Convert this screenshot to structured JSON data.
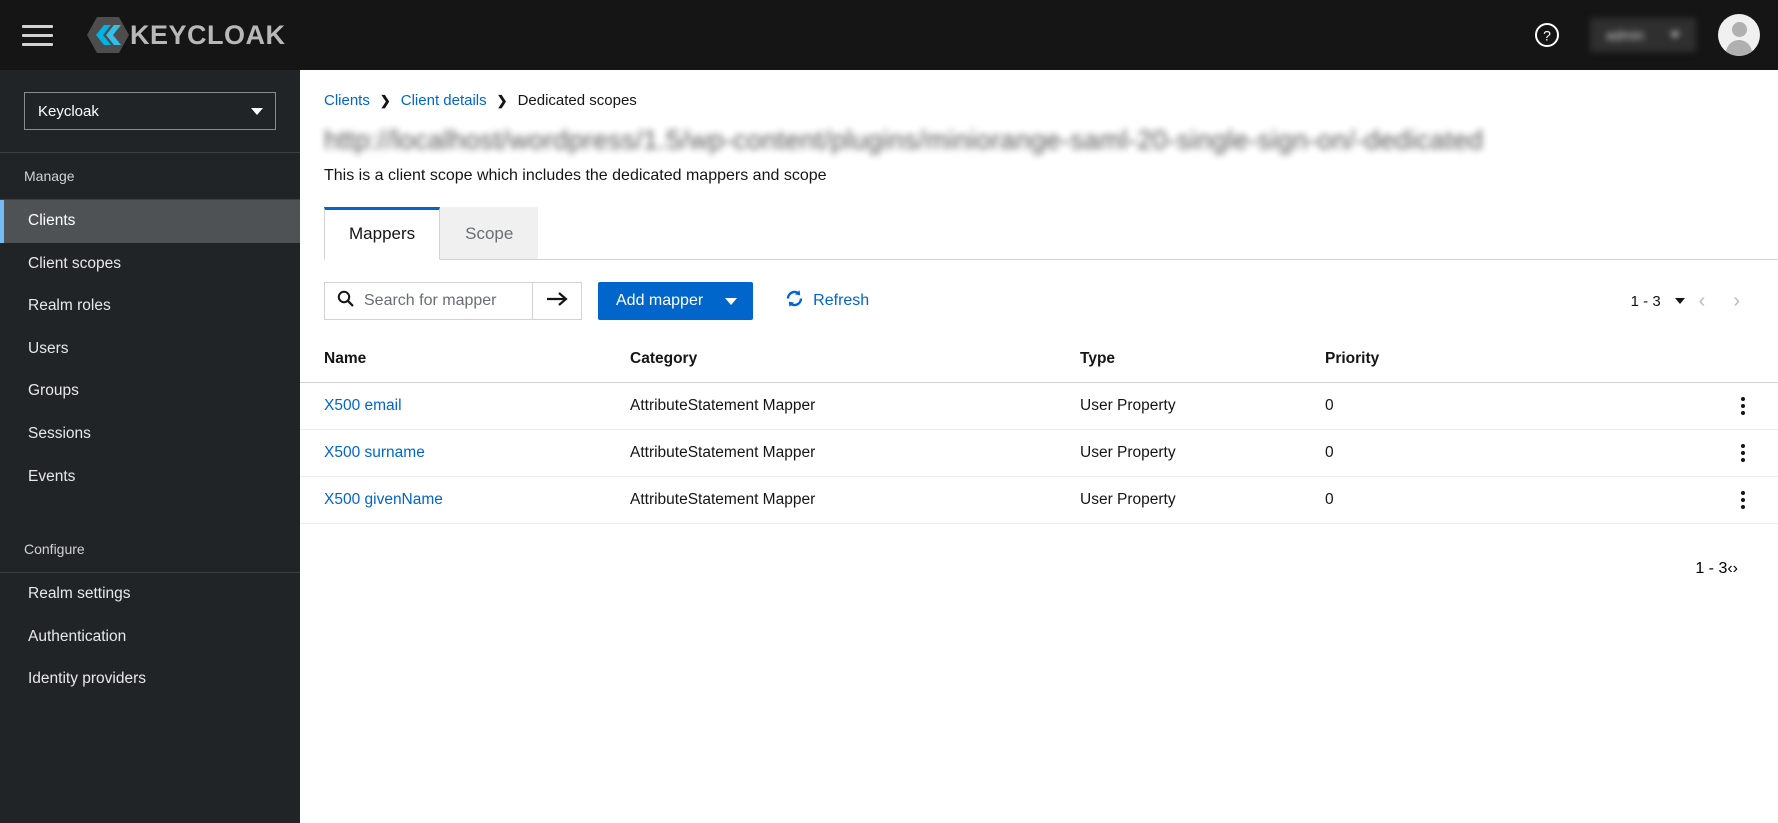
{
  "masthead": {
    "hamburger_label": "Global navigation",
    "brand_name": "KEYCLOAK",
    "help_label": "?",
    "user_name": "admin",
    "avatar_label": "User avatar"
  },
  "sidebar": {
    "realm_selected": "Keycloak",
    "sections": [
      {
        "label": "Manage",
        "items": [
          {
            "label": "Clients",
            "active": true
          },
          {
            "label": "Client scopes",
            "active": false
          },
          {
            "label": "Realm roles",
            "active": false
          },
          {
            "label": "Users",
            "active": false
          },
          {
            "label": "Groups",
            "active": false
          },
          {
            "label": "Sessions",
            "active": false
          },
          {
            "label": "Events",
            "active": false
          }
        ]
      },
      {
        "label": "Configure",
        "items": [
          {
            "label": "Realm settings",
            "active": false
          },
          {
            "label": "Authentication",
            "active": false
          },
          {
            "label": "Identity providers",
            "active": false
          }
        ]
      }
    ]
  },
  "breadcrumb": {
    "item1": "Clients",
    "sep1": "❯",
    "item2": "Client details",
    "sep2": "❯",
    "current": "Dedicated scopes"
  },
  "page": {
    "title": "http://localhost/wordpress/1.5/wp-content/plugins/miniorange-saml-20-single-sign-on/-dedicated",
    "subtitle": "This is a client scope which includes the dedicated mappers and scope"
  },
  "tabs": [
    {
      "label": "Mappers",
      "active": true
    },
    {
      "label": "Scope",
      "active": false
    }
  ],
  "toolbar": {
    "search_placeholder": "Search for mapper",
    "search_value": "",
    "search_submit_icon": "arrow-right-icon",
    "add_mapper_label": "Add mapper",
    "refresh_label": "Refresh"
  },
  "pagination_top": {
    "range": "1 - 3",
    "prev_icon": "‹",
    "next_icon": "›"
  },
  "pagination_bottom": {
    "range": "1 - 3",
    "prev_icon": "‹",
    "next_icon": "›"
  },
  "table": {
    "columns": [
      "Name",
      "Category",
      "Type",
      "Priority"
    ],
    "rows": [
      {
        "name": "X500 email",
        "category": "AttributeStatement Mapper",
        "type": "User Property",
        "priority": "0"
      },
      {
        "name": "X500 surname",
        "category": "AttributeStatement Mapper",
        "type": "User Property",
        "priority": "0"
      },
      {
        "name": "X500 givenName",
        "category": "AttributeStatement Mapper",
        "type": "User Property",
        "priority": "0"
      }
    ]
  },
  "colors": {
    "masthead_bg": "#151515",
    "sidebar_bg": "#212427",
    "accent_blue": "#0066cc",
    "active_nav_bg": "#4f5255",
    "active_nav_bar": "#73bcf7"
  }
}
